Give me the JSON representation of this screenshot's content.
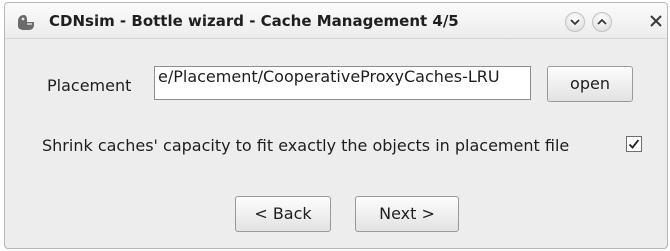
{
  "window": {
    "title": "CDNsim - Bottle wizard - Cache Management 4/5",
    "app_icon": "app-icon",
    "controls": {
      "minimize": "chevron-down-icon",
      "maximize": "chevron-up-icon",
      "close": "close-icon"
    }
  },
  "placement": {
    "label": "Placement",
    "value": "e/Placement/CooperativeProxyCaches-LRU",
    "open_label": "open"
  },
  "shrink": {
    "label": "Shrink caches' capacity to fit exactly the objects in placement file",
    "checked": true
  },
  "nav": {
    "back_label": "< Back",
    "next_label": "Next >"
  }
}
